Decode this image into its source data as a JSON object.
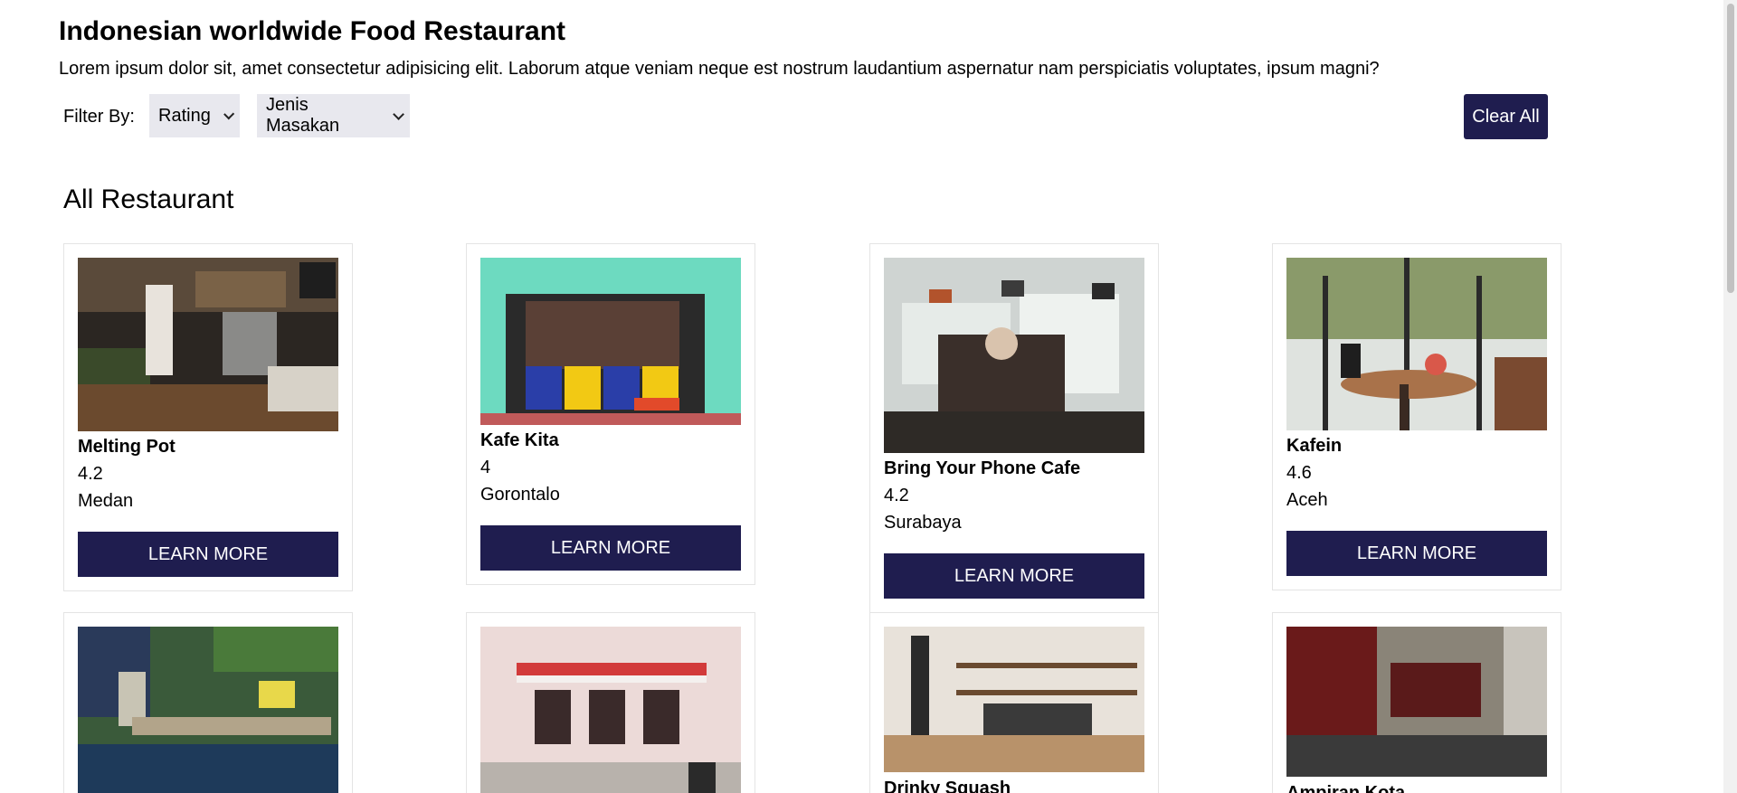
{
  "page": {
    "title": "Indonesian worldwide Food Restaurant",
    "description": "Lorem ipsum dolor sit, amet consectetur adipisicing elit. Laborum atque veniam neque est nostrum laudantium aspernatur nam perspiciatis voluptates, ipsum magni?"
  },
  "filters": {
    "label": "Filter By:",
    "rating": "Rating",
    "cuisine": "Jenis Masakan",
    "clear_label": "Clear All"
  },
  "section": {
    "title": "All Restaurant"
  },
  "restaurants": [
    {
      "name": "Melting Pot",
      "rating": "4.2",
      "city": "Medan",
      "button": "LEARN MORE"
    },
    {
      "name": "Kafe Kita",
      "rating": "4",
      "city": "Gorontalo",
      "button": "LEARN MORE"
    },
    {
      "name": "Bring Your Phone Cafe",
      "rating": "4.2",
      "city": "Surabaya",
      "button": "LEARN MORE"
    },
    {
      "name": "Kafein",
      "rating": "4.6",
      "city": "Aceh",
      "button": "LEARN MORE"
    },
    {
      "name": "",
      "rating": "",
      "city": "",
      "button": ""
    },
    {
      "name": "",
      "rating": "",
      "city": "",
      "button": ""
    },
    {
      "name": "Drinky Squash",
      "rating": "",
      "city": "",
      "button": ""
    },
    {
      "name": "Ampiran Kota",
      "rating": "",
      "city": "",
      "button": ""
    }
  ],
  "colors": {
    "primary": "#1f1d4f",
    "select_bg": "#e8e8ee",
    "card_border": "#e4e4e4"
  }
}
